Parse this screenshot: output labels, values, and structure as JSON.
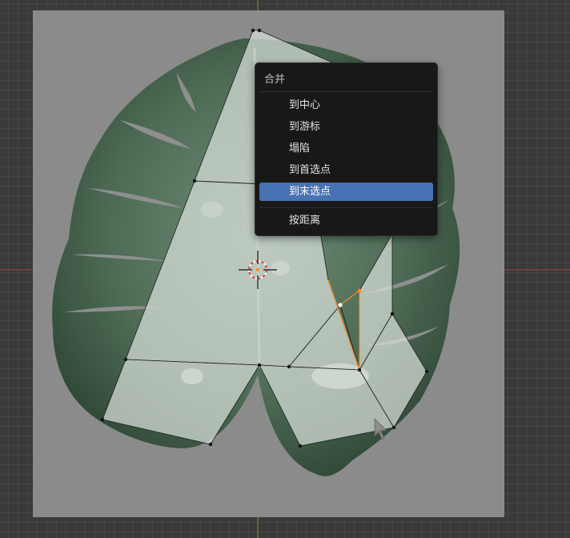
{
  "viewport": {
    "image": "monstera-leaf-reference",
    "grid_color": "#3a3a3a",
    "x_axis_color": "#c44b4b",
    "y_axis_color": "#6a9a3a",
    "selected_color": "#ff8a1e",
    "cursor_icon": "3d-cursor-icon",
    "pointer_icon": "mouse-pointer-icon"
  },
  "menu": {
    "title": "合并",
    "items": [
      {
        "label": "到中心",
        "highlighted": false
      },
      {
        "label": "到游标",
        "highlighted": false
      },
      {
        "label": "塌陷",
        "highlighted": false
      },
      {
        "label": "到首选点",
        "highlighted": false
      },
      {
        "label": "到末选点",
        "highlighted": true
      },
      {
        "label": "按距离",
        "highlighted": false
      }
    ],
    "highlight_color": "#4772b3"
  }
}
